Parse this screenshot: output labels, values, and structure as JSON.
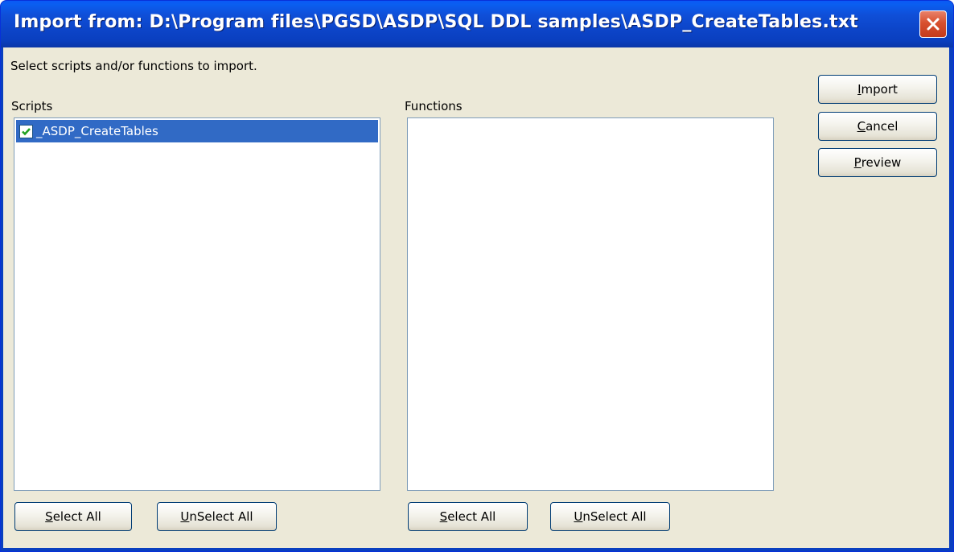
{
  "window": {
    "title": "Import from: D:\\Program files\\PGSD\\ASDP\\SQL DDL samples\\ASDP_CreateTables.txt"
  },
  "instructions": "Select scripts and/or functions to import.",
  "scripts": {
    "label": "Scripts",
    "items": [
      {
        "label": "_ASDP_CreateTables",
        "checked": true,
        "selected": true
      }
    ],
    "select_all": {
      "mnemonic": "S",
      "rest": "elect All"
    },
    "unselect_all": {
      "mnemonic": "U",
      "rest": "nSelect All"
    }
  },
  "functions": {
    "label": "Functions",
    "items": [],
    "select_all": {
      "mnemonic": "S",
      "rest": "elect All"
    },
    "unselect_all": {
      "mnemonic": "U",
      "rest": "nSelect All"
    }
  },
  "actions": {
    "import": {
      "mnemonic": "I",
      "rest": "mport"
    },
    "cancel": {
      "mnemonic": "C",
      "rest": "ancel"
    },
    "preview": {
      "mnemonic": "P",
      "rest": "review"
    }
  },
  "colors": {
    "titlebar": "#0c45c9",
    "client": "#ece9d8",
    "selection": "#316ac5",
    "check": "#21a121",
    "close": "#d8502f"
  },
  "icons": {
    "close": "close-icon",
    "check": "checkmark-icon"
  }
}
